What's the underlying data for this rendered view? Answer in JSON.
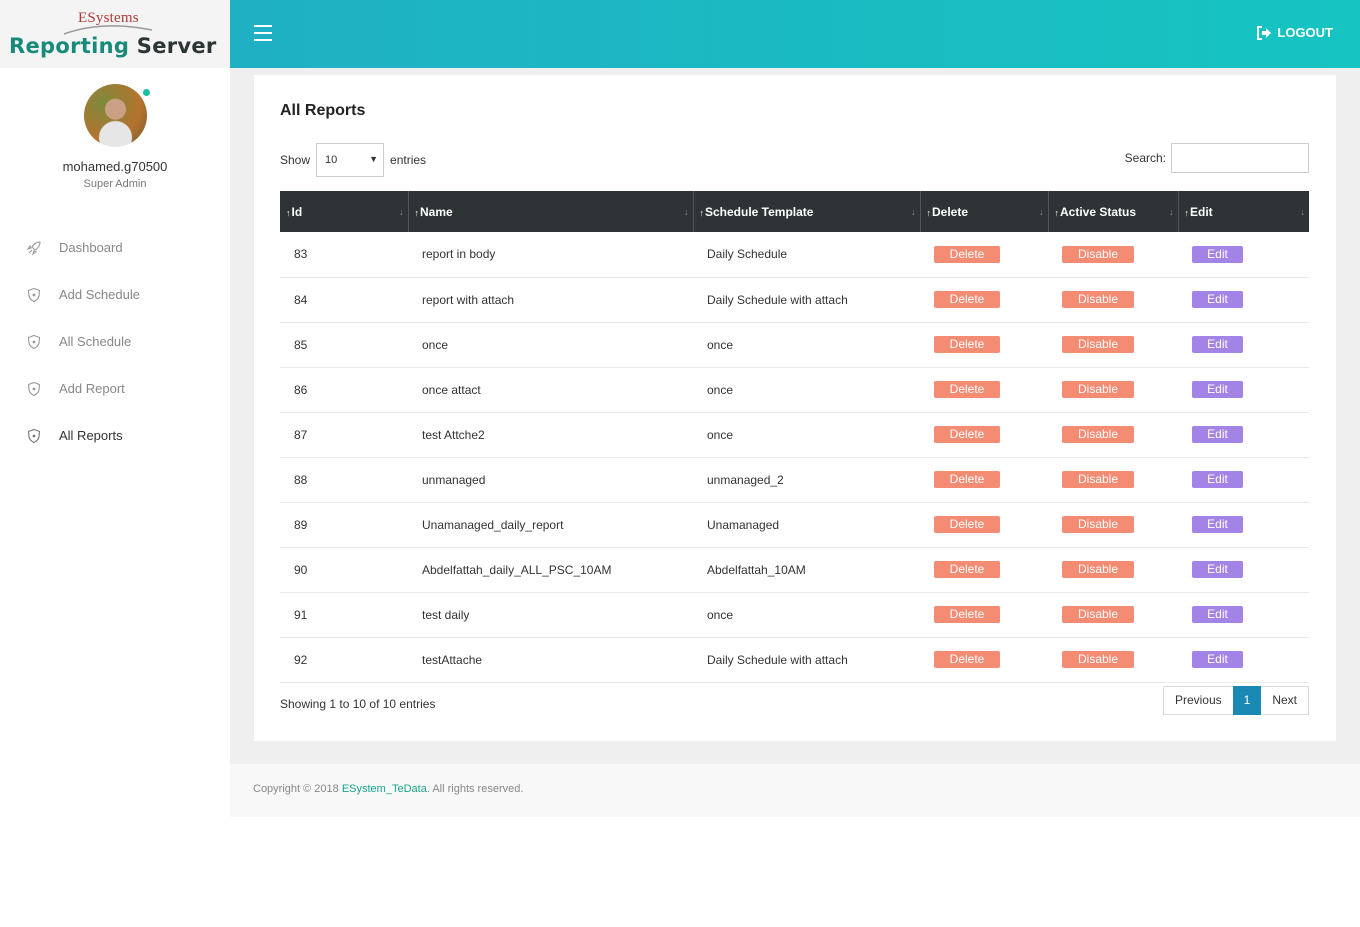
{
  "brand": {
    "company": "ESystems",
    "title_part1": "Reporting ",
    "title_part2": "Server"
  },
  "user": {
    "name": "mohamed.g70500",
    "role": "Super Admin"
  },
  "sidebar": {
    "items": [
      {
        "label": "Dashboard",
        "icon": "rocket-icon"
      },
      {
        "label": "Add Schedule",
        "icon": "shield-icon"
      },
      {
        "label": "All Schedule",
        "icon": "shield-icon"
      },
      {
        "label": "Add Report",
        "icon": "shield-icon"
      },
      {
        "label": "All Reports",
        "icon": "shield-icon",
        "active": true
      }
    ]
  },
  "topbar": {
    "logout_label": "LOGOUT"
  },
  "page": {
    "title": "All Reports",
    "show_label": "Show",
    "entries_label": "entries",
    "page_size": "10",
    "search_label": "Search:",
    "search_value": ""
  },
  "table": {
    "columns": [
      "Id",
      "Name",
      "Schedule Template",
      "Delete",
      "Active Status",
      "Edit"
    ],
    "rows": [
      {
        "id": "83",
        "name": "report in body",
        "template": "Daily Schedule",
        "delete": "Delete",
        "status": "Disable",
        "edit": "Edit"
      },
      {
        "id": "84",
        "name": "report with attach",
        "template": "Daily Schedule with attach",
        "delete": "Delete",
        "status": "Disable",
        "edit": "Edit"
      },
      {
        "id": "85",
        "name": "once",
        "template": "once",
        "delete": "Delete",
        "status": "Disable",
        "edit": "Edit"
      },
      {
        "id": "86",
        "name": "once attact",
        "template": "once",
        "delete": "Delete",
        "status": "Disable",
        "edit": "Edit"
      },
      {
        "id": "87",
        "name": "test Attche2",
        "template": "once",
        "delete": "Delete",
        "status": "Disable",
        "edit": "Edit"
      },
      {
        "id": "88",
        "name": "unmanaged",
        "template": "unmanaged_2",
        "delete": "Delete",
        "status": "Disable",
        "edit": "Edit"
      },
      {
        "id": "89",
        "name": "Unamanaged_daily_report",
        "template": "Unamanaged",
        "delete": "Delete",
        "status": "Disable",
        "edit": "Edit"
      },
      {
        "id": "90",
        "name": "Abdelfattah_daily_ALL_PSC_10AM",
        "template": "Abdelfattah_10AM",
        "delete": "Delete",
        "status": "Disable",
        "edit": "Edit"
      },
      {
        "id": "91",
        "name": "test daily",
        "template": "once",
        "delete": "Delete",
        "status": "Disable",
        "edit": "Edit"
      },
      {
        "id": "92",
        "name": "testAttache",
        "template": "Daily Schedule with attach",
        "delete": "Delete",
        "status": "Disable",
        "edit": "Edit"
      }
    ]
  },
  "pagination": {
    "info": "Showing 1 to 10 of 10 entries",
    "previous": "Previous",
    "current": "1",
    "next": "Next"
  },
  "footer": {
    "prefix": "Copyright © 2018 ",
    "link": "ESystem_TeData",
    "suffix": ". All rights reserved."
  },
  "colors": {
    "topbar": "#16c4c2",
    "sidebar_bg": "#ffffff",
    "table_header": "#2e3435",
    "delete_btn": "#f48b73",
    "disable_btn": "#f48b73",
    "edit_btn": "#a384e6",
    "pager_active": "#1a8ab4",
    "footer_link": "#1aa58a"
  }
}
